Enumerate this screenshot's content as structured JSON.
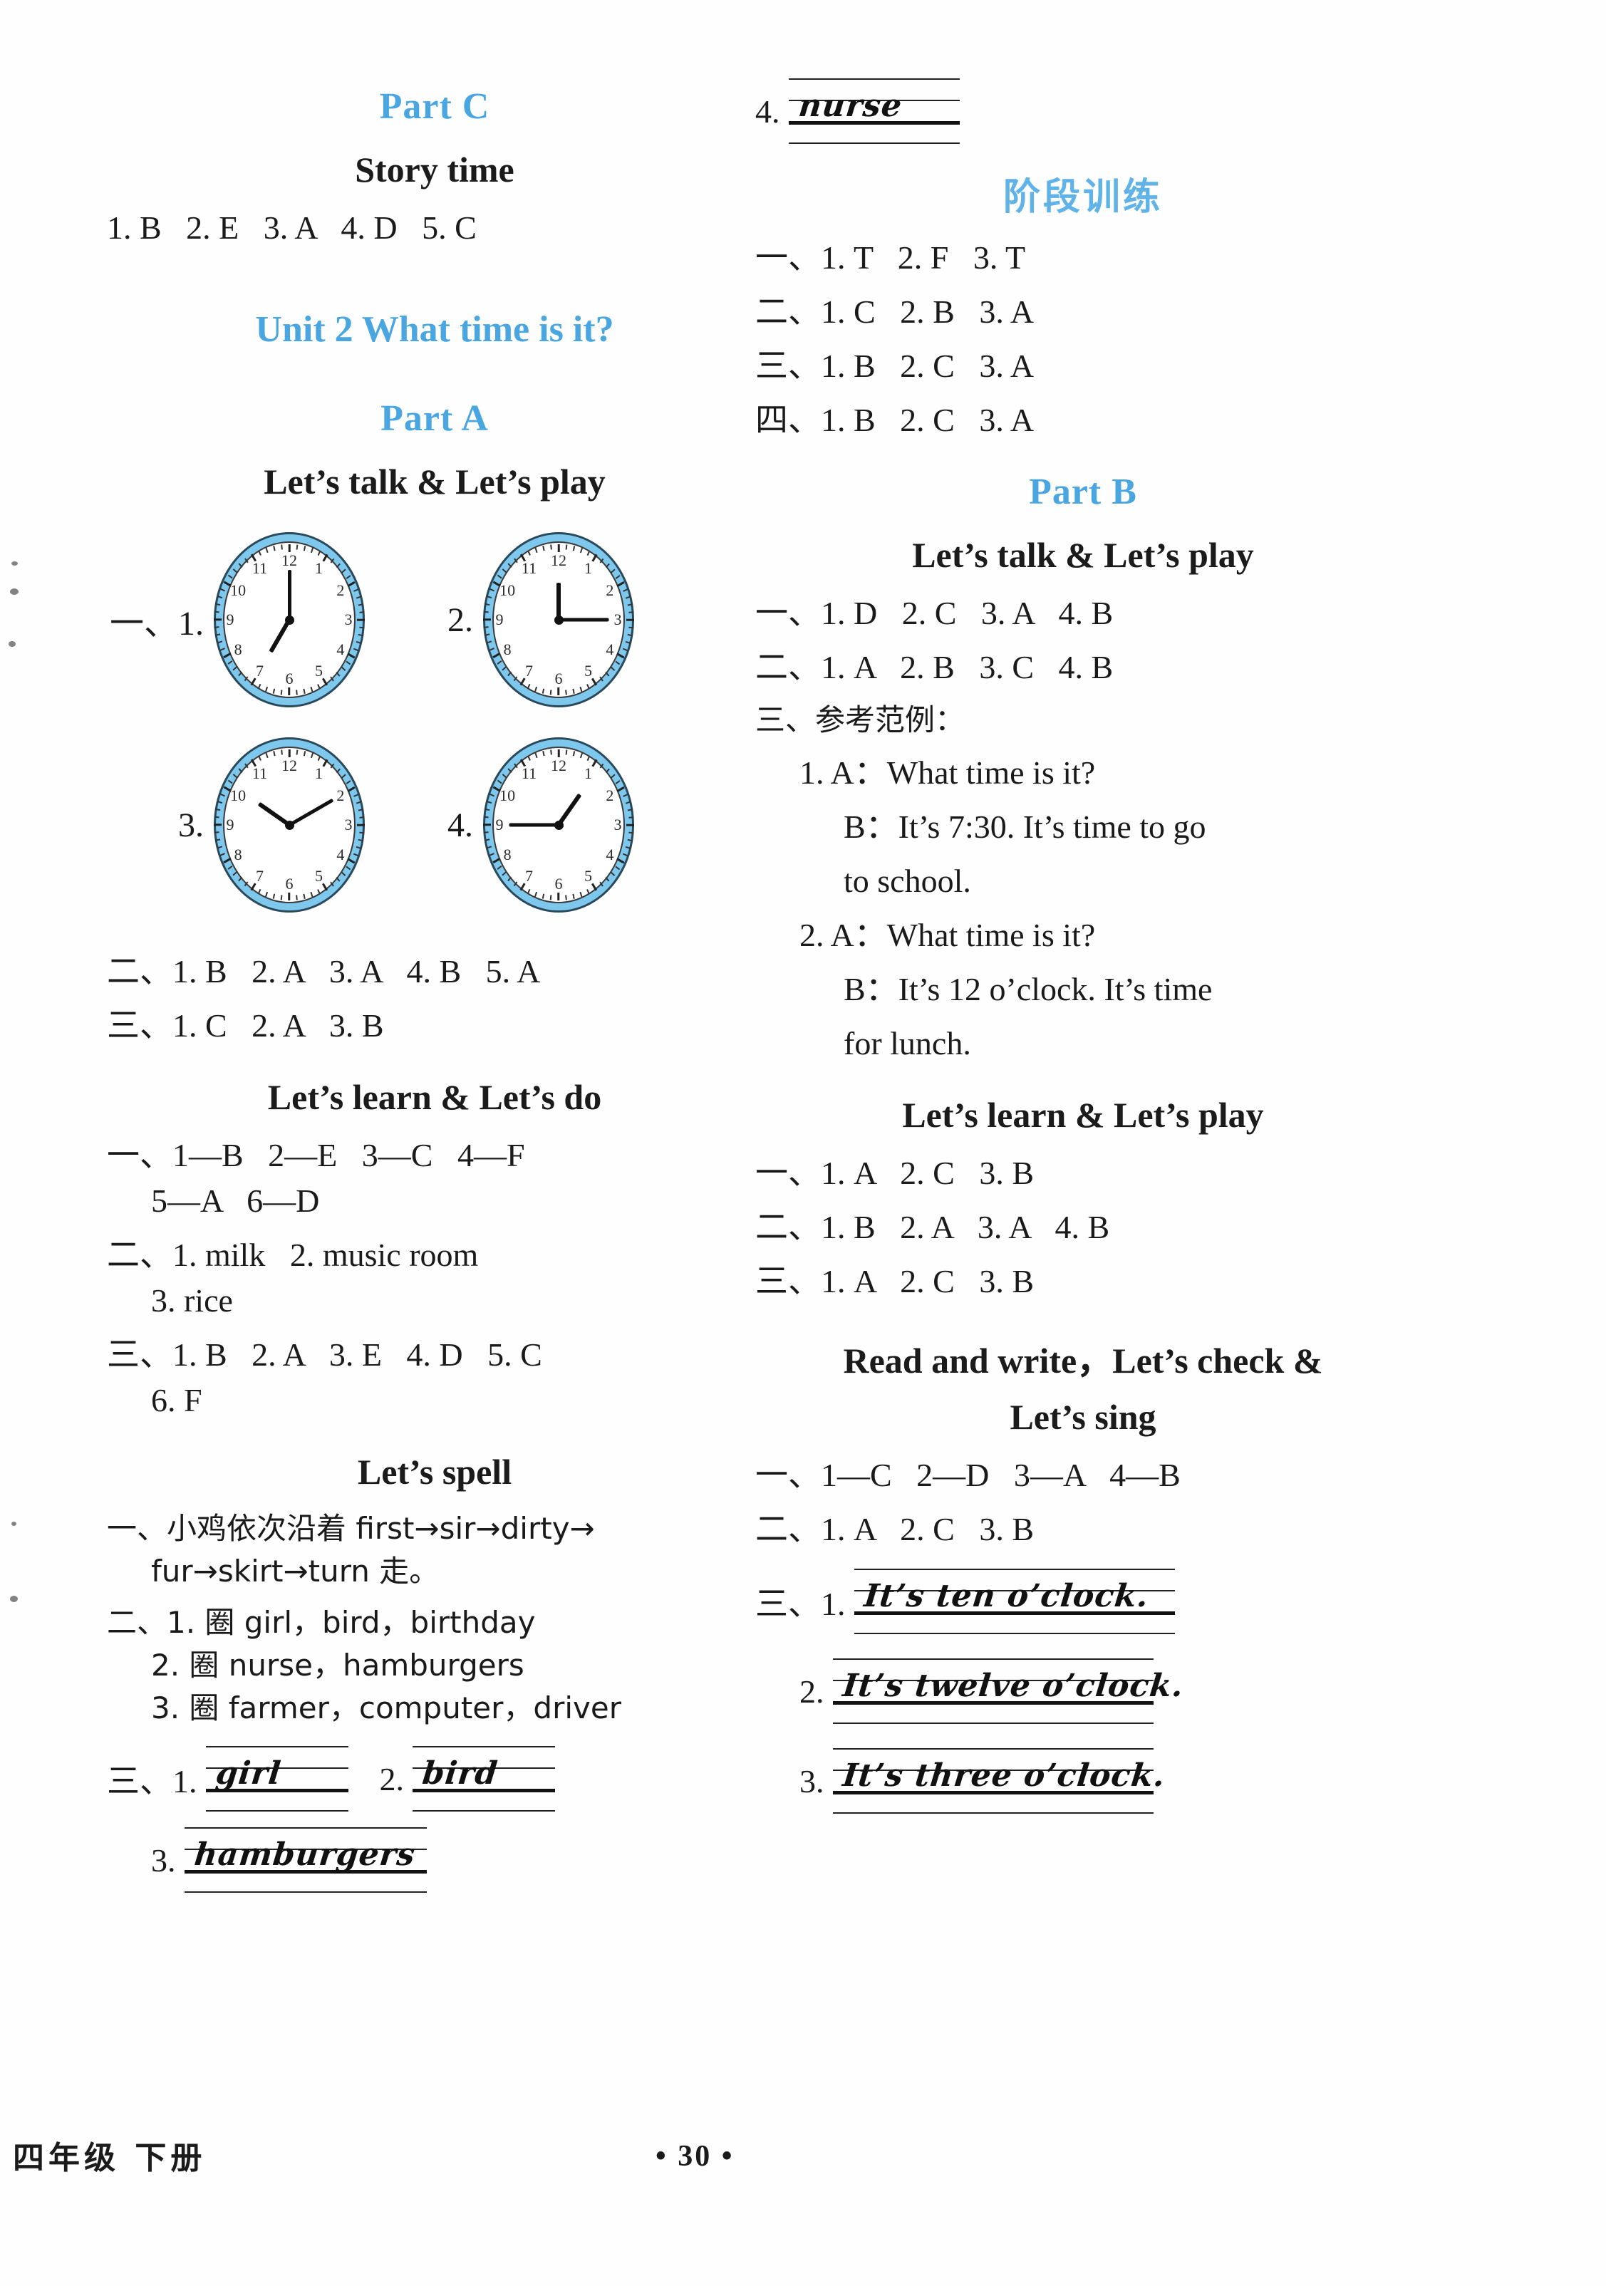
{
  "page": {
    "number": "• 30 •",
    "footer_label": "四年级  下册"
  },
  "left_column": {
    "part_c_heading": "Part C",
    "story_time_heading": "Story time",
    "story_time_answers": "1. B   2. E   3. A   4. D   5. C",
    "unit_title": "Unit 2    What time is it?",
    "part_a_heading": "Part A",
    "lets_talk_play_heading": "Let’s talk & Let’s play",
    "clocks": [
      {
        "label": "一、1.",
        "time": "7:00",
        "hour_deg": 210,
        "minute_deg": 0
      },
      {
        "label": "2.",
        "time": "12:15",
        "hour_deg": 0,
        "minute_deg": 90
      },
      {
        "label": "3.",
        "time": "10:10",
        "hour_deg": 305,
        "minute_deg": 60
      },
      {
        "label": "4.",
        "time": "12:45",
        "hour_deg": 35,
        "minute_deg": 270
      }
    ],
    "talk_play_answers": [
      "二、1. B   2. A   3. A   4. B   5. A",
      "三、1. C   2. A   3. B"
    ],
    "lets_learn_do_heading": "Let’s learn & Let’s do",
    "learn_do_answers": [
      "一、1—B   2—E   3—C   4—F",
      "5—A   6—D",
      "二、1. milk   2. music room",
      "3. rice",
      "三、1. B   2. A   3. E   4. D   5. C",
      "6. F"
    ],
    "lets_spell_heading": "Let’s spell",
    "spell_answers": [
      "一、小鸡依次沿着 first→sir→dirty→",
      "fur→skirt→turn 走。",
      "二、1. 圈 girl，bird，birthday",
      "2. 圈 nurse，hamburgers",
      "3. 圈 farmer，computer，driver"
    ],
    "spell_written": {
      "prefix_label": "三、1.",
      "items": [
        {
          "label": "三、1.",
          "word": "girl"
        },
        {
          "label": "2.",
          "word": "bird"
        },
        {
          "label": "3.",
          "word": "hamburgers"
        }
      ]
    }
  },
  "right_column": {
    "nurse_item": {
      "label": "4.",
      "word": "nurse"
    },
    "stage_training_heading": "阶段训练",
    "stage_training_answers": [
      "一、1. T   2. F   3. T",
      "二、1. C   2. B   3. A",
      "三、1. B   2. C   3. A",
      "四、1. B   2. C   3. A"
    ],
    "part_b_heading": "Part B",
    "lets_talk_play_heading": "Let’s talk & Let’s play",
    "talk_play_answers": [
      "一、1. D   2. C   3. A   4. B",
      "二、1. A   2. B   3. C   4. B",
      "三、参考范例："
    ],
    "dialogues": [
      "1. A：What time is it?",
      "B：It’s 7:30. It’s time to go",
      "to school.",
      "2. A：What time is it?",
      "B：It’s 12 o’clock. It’s time",
      "for lunch."
    ],
    "lets_learn_play_heading": "Let’s learn & Let’s play",
    "learn_play_answers": [
      "一、1. A   2. C   3. B",
      "二、1. B   2. A   3. A   4. B",
      "三、1. A   2. C   3. B"
    ],
    "read_write_heading_line1": "Read and write，Let’s check &",
    "read_write_heading_line2": "Let’s sing",
    "read_write_answers": [
      "一、1—C   2—D   3—A   4—B",
      "二、1. A   2. C   3. B"
    ],
    "written_sentences": {
      "items": [
        {
          "label": "三、1.",
          "text": "It’s ten o’clock."
        },
        {
          "label": "2.",
          "text": "It’s twelve o’clock."
        },
        {
          "label": "3.",
          "text": "It’s three o’clock."
        }
      ]
    }
  },
  "colors": {
    "heading_blue": "#4aa6e0",
    "clock_rim": "#7ec8ee",
    "text_black": "#1a1a1a"
  }
}
